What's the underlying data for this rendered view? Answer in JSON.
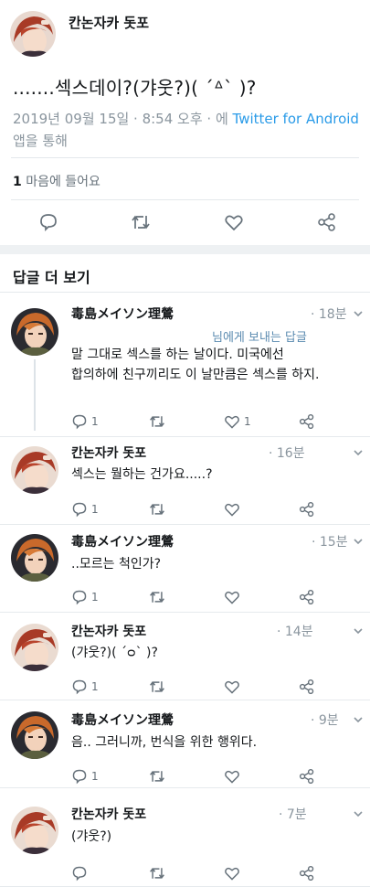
{
  "main_tweet": {
    "author": "칸논자카 돗포",
    "text": ".......섹스데이?(갸웃?)( ´ᐞ` )?",
    "meta_prefix": "2019년 09월 15일 · 8:54 오후 · 에 ",
    "meta_link": "Twitter for Android",
    "meta_suffix": " 앱을 통해",
    "likes_count": "1",
    "likes_label": " 마음에 들어요"
  },
  "more_replies_title": "답글 더 보기",
  "replies": [
    {
      "author": "毒島メイソン理鶯",
      "time": "· 18분",
      "reply_to": "님에게 보내는 답글",
      "text_line1": "말 그대로 섹스를 하는 날이다. 미국에선",
      "text_line2": "합의하에 친구끼리도 이 날만큼은 섹스를 하지.",
      "reply_count": "1",
      "like_count": "1"
    },
    {
      "author": "칸논자카 돗포",
      "time": "· 16분",
      "text_line1": "섹스는 뭘하는 건가요.....?",
      "reply_count": "1"
    },
    {
      "author": "毒島メイソン理鶯",
      "time": "· 15분",
      "text_line1": "..모르는 척인가?",
      "reply_count": "1"
    },
    {
      "author": "칸논자카 돗포",
      "time": "· 14분",
      "text_line1": "(갸웃?)( ´ᴑ` )?",
      "reply_count": "1"
    },
    {
      "author": "毒島メイソン理鶯",
      "time": "· 9분",
      "text_line1": "음.. 그러니까, 번식을 위한 행위다.",
      "reply_count": "1"
    },
    {
      "author": "칸논자카 돗포",
      "time": "· 7분",
      "text_line1": "(갸웃?)"
    }
  ],
  "icons": {
    "reply": "speech-bubble-icon",
    "retweet": "retweet-icon",
    "like": "heart-icon",
    "share": "share-icon",
    "menu": "chevron-down-icon"
  },
  "colors": {
    "link": "#2a9be8",
    "meta_gray": "#8a959e",
    "icon_gray": "#66717a",
    "band": "#eef1f3"
  }
}
